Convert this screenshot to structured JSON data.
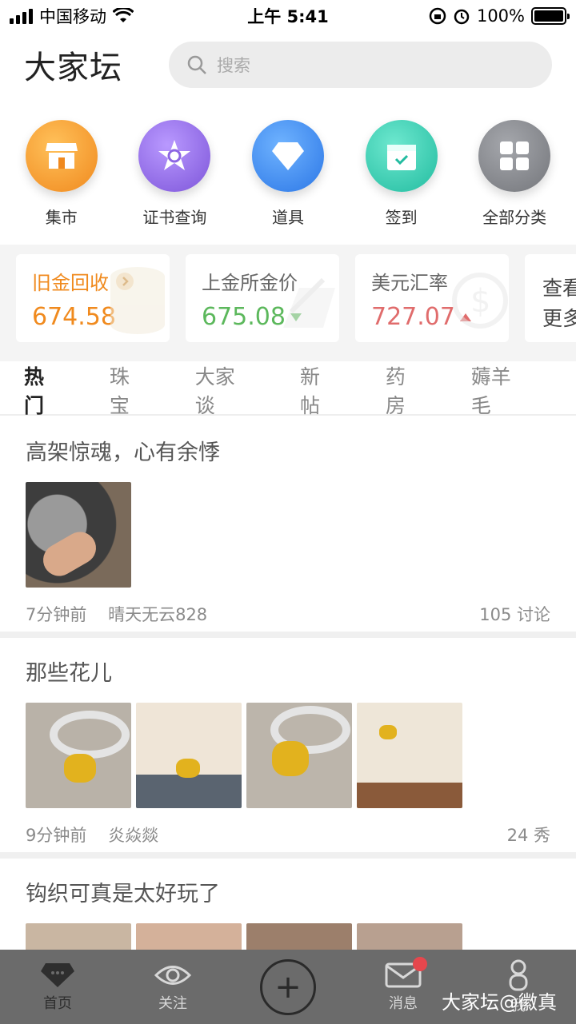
{
  "status": {
    "carrier": "中国移动",
    "time": "上午 5:41",
    "battery": "100%"
  },
  "header": {
    "logo": "大家坛",
    "search_placeholder": "搜索"
  },
  "categories": [
    {
      "label": "集市",
      "color": "#f39a2a"
    },
    {
      "label": "证书查询",
      "color": "#9b73e6"
    },
    {
      "label": "道具",
      "color": "#3f8cf0"
    },
    {
      "label": "签到",
      "color": "#3ccfb3"
    },
    {
      "label": "全部分类",
      "color": "#888a8f"
    }
  ],
  "prices": [
    {
      "title": "旧金回收",
      "value": "674.58",
      "color": "#f08a1e"
    },
    {
      "title": "上金所金价",
      "value": "675.08",
      "color": "#5cb85c"
    },
    {
      "title": "美元汇率",
      "value": "727.07",
      "color": "#e06c6c"
    }
  ],
  "prices_more": {
    "line1": "查看",
    "line2": "更多"
  },
  "tabs": [
    "热门",
    "珠宝",
    "大家谈",
    "新帖",
    "药房",
    "薅羊毛"
  ],
  "posts": [
    {
      "title": "高架惊魂，心有余悸",
      "time": "7分钟前",
      "author": "晴天无云828",
      "count": "105",
      "kind": "讨论"
    },
    {
      "title": "那些花儿",
      "time": "9分钟前",
      "author": "炎焱燚",
      "count": "24",
      "kind": "秀"
    },
    {
      "title": "钩织可真是太好玩了"
    }
  ],
  "nav": {
    "home": "首页",
    "follow": "关注",
    "messages": "消息",
    "me": "我"
  },
  "watermark": "大家坛@徽真"
}
